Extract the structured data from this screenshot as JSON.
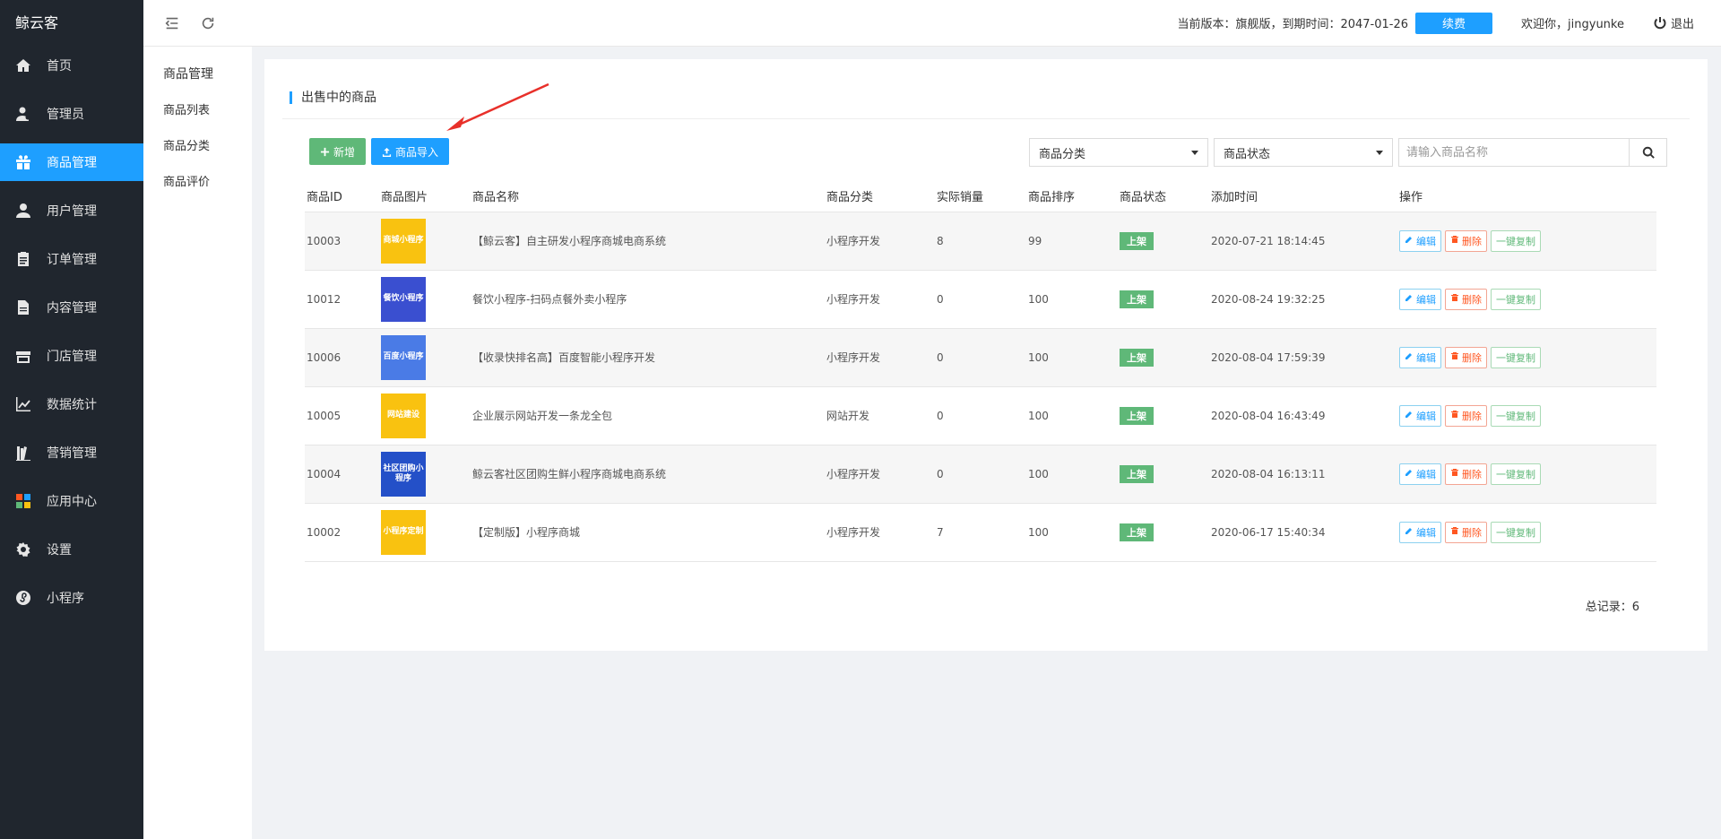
{
  "brand": "鲸云客",
  "nav": [
    {
      "label": "首页",
      "icon": "home-icon"
    },
    {
      "label": "管理员",
      "icon": "admin-icon"
    },
    {
      "label": "商品管理",
      "icon": "gift-icon",
      "active": true
    },
    {
      "label": "用户管理",
      "icon": "user-icon"
    },
    {
      "label": "订单管理",
      "icon": "clipboard-icon"
    },
    {
      "label": "内容管理",
      "icon": "document-icon"
    },
    {
      "label": "门店管理",
      "icon": "store-icon"
    },
    {
      "label": "数据统计",
      "icon": "line-chart-icon"
    },
    {
      "label": "营销管理",
      "icon": "books-icon"
    },
    {
      "label": "应用中心",
      "icon": "apps-icon"
    },
    {
      "label": "设置",
      "icon": "gear-icon"
    },
    {
      "label": "小程序",
      "icon": "miniapp-icon"
    }
  ],
  "subnav": {
    "title": "商品管理",
    "items": [
      "商品列表",
      "商品分类",
      "商品评价"
    ]
  },
  "header": {
    "version_text": "当前版本：旗舰版，到期时间：2047-01-26",
    "renew_label": "续费",
    "welcome": "欢迎你，jingyunke",
    "logout": "退出"
  },
  "card": {
    "title": "出售中的商品",
    "add_label": "新增",
    "import_label": "商品导入",
    "category_select": "商品分类",
    "status_select": "商品状态",
    "search_placeholder": "请输入商品名称"
  },
  "table": {
    "columns": [
      "商品ID",
      "商品图片",
      "商品名称",
      "商品分类",
      "实际销量",
      "商品排序",
      "商品状态",
      "添加时间",
      "操作"
    ],
    "rows": [
      {
        "id": "10003",
        "thumb": "商城小程序",
        "name": "【鲸云客】自主研发小程序商城电商系统",
        "category": "小程序开发",
        "sales": "8",
        "sort": "99",
        "status": "上架",
        "time": "2020-07-21 18:14:45"
      },
      {
        "id": "10012",
        "thumb": "餐饮小程序",
        "name": "餐饮小程序-扫码点餐外卖小程序",
        "category": "小程序开发",
        "sales": "0",
        "sort": "100",
        "status": "上架",
        "time": "2020-08-24 19:32:25"
      },
      {
        "id": "10006",
        "thumb": "百度小程序",
        "name": "【收录快排名高】百度智能小程序开发",
        "category": "小程序开发",
        "sales": "0",
        "sort": "100",
        "status": "上架",
        "time": "2020-08-04 17:59:39"
      },
      {
        "id": "10005",
        "thumb": "网站建设",
        "name": "企业展示网站开发一条龙全包",
        "category": "网站开发",
        "sales": "0",
        "sort": "100",
        "status": "上架",
        "time": "2020-08-04 16:43:49"
      },
      {
        "id": "10004",
        "thumb": "社区团购小程序",
        "name": "鲸云客社区团购生鲜小程序商城电商系统",
        "category": "小程序开发",
        "sales": "0",
        "sort": "100",
        "status": "上架",
        "time": "2020-08-04 16:13:11"
      },
      {
        "id": "10002",
        "thumb": "小程序定制",
        "name": "【定制版】小程序商城",
        "category": "小程序开发",
        "sales": "7",
        "sort": "100",
        "status": "上架",
        "time": "2020-06-17 15:40:34"
      }
    ],
    "ops": {
      "edit": "编辑",
      "delete": "删除",
      "copy": "一键复制"
    }
  },
  "total": "总记录：6",
  "colors": {
    "accent": "#1e9fff",
    "green": "#5fb878",
    "danger": "#ff5722",
    "sidebar": "#20262e"
  }
}
